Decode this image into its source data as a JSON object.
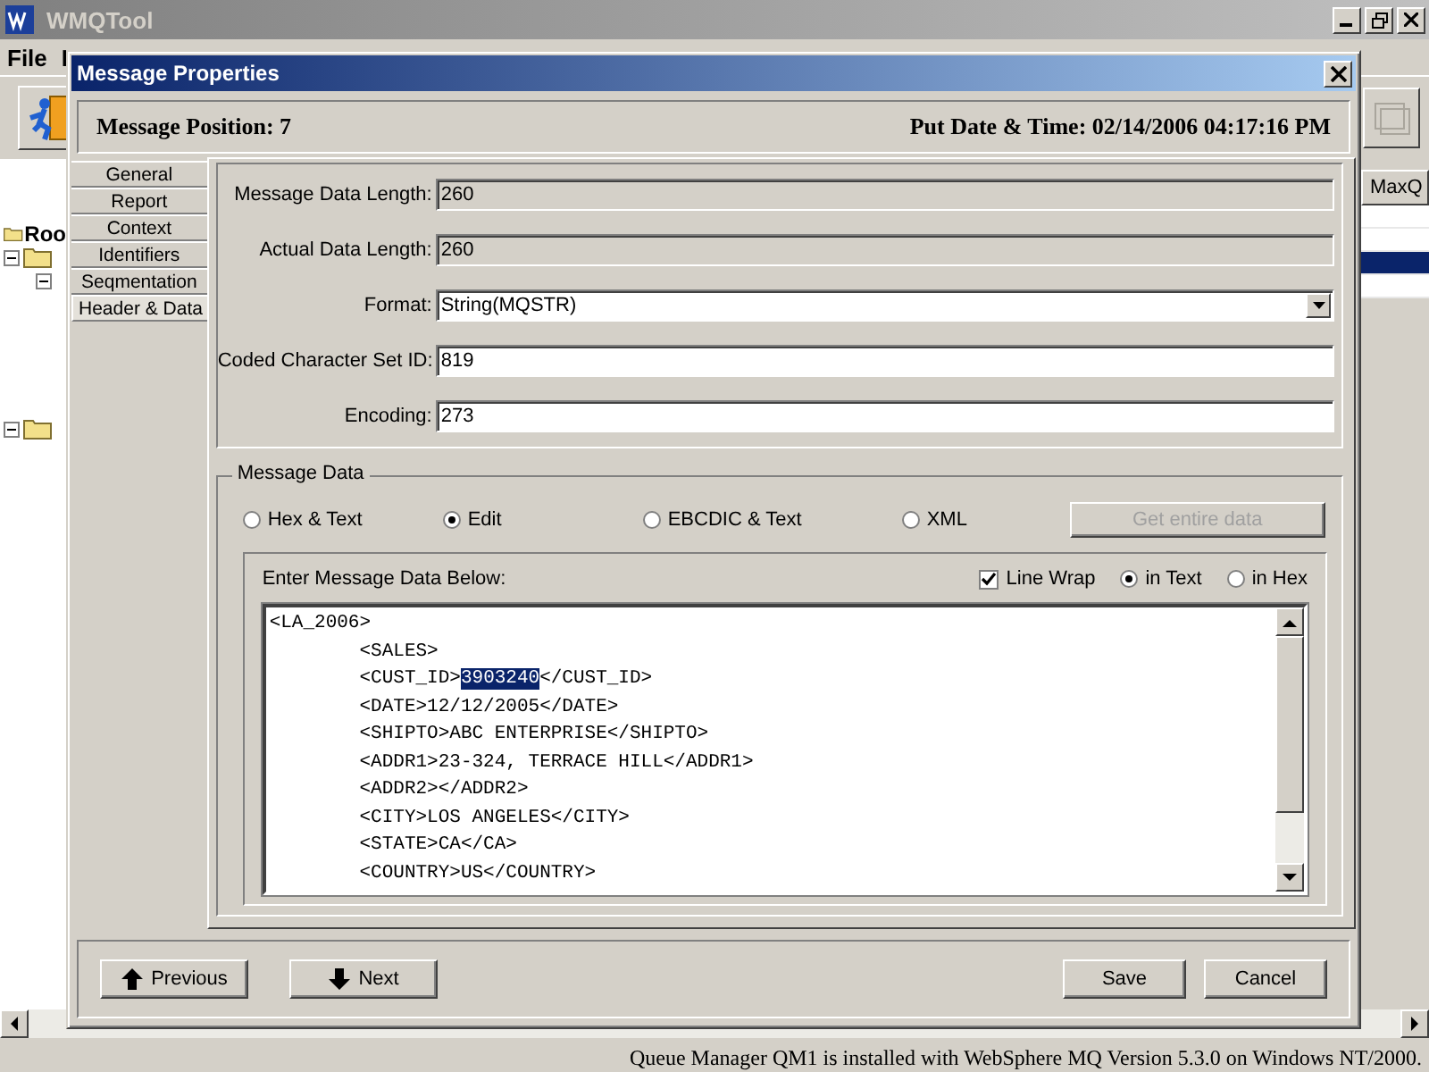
{
  "app": {
    "title": "WMQTool",
    "menu": [
      "File",
      "I"
    ],
    "tree_root": "Roo",
    "column_header": "MaxQ",
    "list_rows": [
      {
        "selected": false
      },
      {
        "selected": false
      },
      {
        "selected": true
      },
      {
        "selected": false
      }
    ]
  },
  "dialog": {
    "title": "Message Properties",
    "position": "Message Position: 7",
    "put_date": "Put Date & Time: 02/14/2006 04:17:16 PM",
    "tabs": [
      {
        "label": "General",
        "selected": false
      },
      {
        "label": "Report",
        "selected": false
      },
      {
        "label": "Context",
        "selected": false
      },
      {
        "label": "Identifiers",
        "selected": false
      },
      {
        "label": "Seqmentation",
        "selected": false
      },
      {
        "label": "Header & Data",
        "selected": true
      }
    ],
    "fields": [
      {
        "label": "Message Data Length:",
        "value": "260",
        "kind": "readonly"
      },
      {
        "label": "Actual Data Length:",
        "value": "260",
        "kind": "readonly"
      },
      {
        "label": "Format:",
        "value": "String(MQSTR)",
        "kind": "dropdown"
      },
      {
        "label": "Coded Character Set ID:",
        "value": "819",
        "kind": "text"
      },
      {
        "label": "Encoding:",
        "value": "273",
        "kind": "text"
      }
    ],
    "message_data": {
      "title": "Message Data",
      "view_modes": [
        {
          "label": "Hex & Text",
          "selected": false
        },
        {
          "label": "Edit",
          "selected": true
        },
        {
          "label": "EBCDIC & Text",
          "selected": false
        },
        {
          "label": "XML",
          "selected": false
        }
      ],
      "get_data_button": {
        "label": "Get entire data",
        "disabled": true
      },
      "editor_label": "Enter Message Data Below:",
      "line_wrap": {
        "label": "Line Wrap",
        "checked": true
      },
      "wrap_modes": [
        {
          "label": "in Text",
          "selected": true
        },
        {
          "label": "in Hex",
          "selected": false
        }
      ],
      "lines": [
        {
          "parts": [
            {
              "text": "<LA_2006>",
              "selected": false
            }
          ]
        },
        {
          "parts": [
            {
              "text": "\t<SALES>",
              "selected": false
            }
          ]
        },
        {
          "parts": [
            {
              "text": "\t<CUST_ID>",
              "selected": false
            },
            {
              "text": "3903240",
              "selected": true
            },
            {
              "text": "</CUST_ID>",
              "selected": false
            }
          ]
        },
        {
          "parts": [
            {
              "text": "\t<DATE>12/12/2005</DATE>",
              "selected": false
            }
          ]
        },
        {
          "parts": [
            {
              "text": "\t<SHIPTO>ABC ENTERPRISE</SHIPTO>",
              "selected": false
            }
          ]
        },
        {
          "parts": [
            {
              "text": "\t<ADDR1>23-324, TERRACE HILL</ADDR1>",
              "selected": false
            }
          ]
        },
        {
          "parts": [
            {
              "text": "\t<ADDR2></ADDR2>",
              "selected": false
            }
          ]
        },
        {
          "parts": [
            {
              "text": "\t<CITY>LOS ANGELES</CITY>",
              "selected": false
            }
          ]
        },
        {
          "parts": [
            {
              "text": "\t<STATE>CA</CA>",
              "selected": false
            }
          ]
        },
        {
          "parts": [
            {
              "text": "\t<COUNTRY>US</COUNTRY>",
              "selected": false
            }
          ]
        }
      ]
    },
    "buttons": [
      {
        "label": "Previous",
        "kind": "previous"
      },
      {
        "label": "Next",
        "kind": "next"
      },
      {
        "label": "Save",
        "kind": "plain"
      },
      {
        "label": "Cancel",
        "kind": "plain"
      }
    ]
  },
  "status_bar": "Queue Manager QM1 is installed with WebSphere MQ Version 5.3.0 on Windows NT/2000."
}
